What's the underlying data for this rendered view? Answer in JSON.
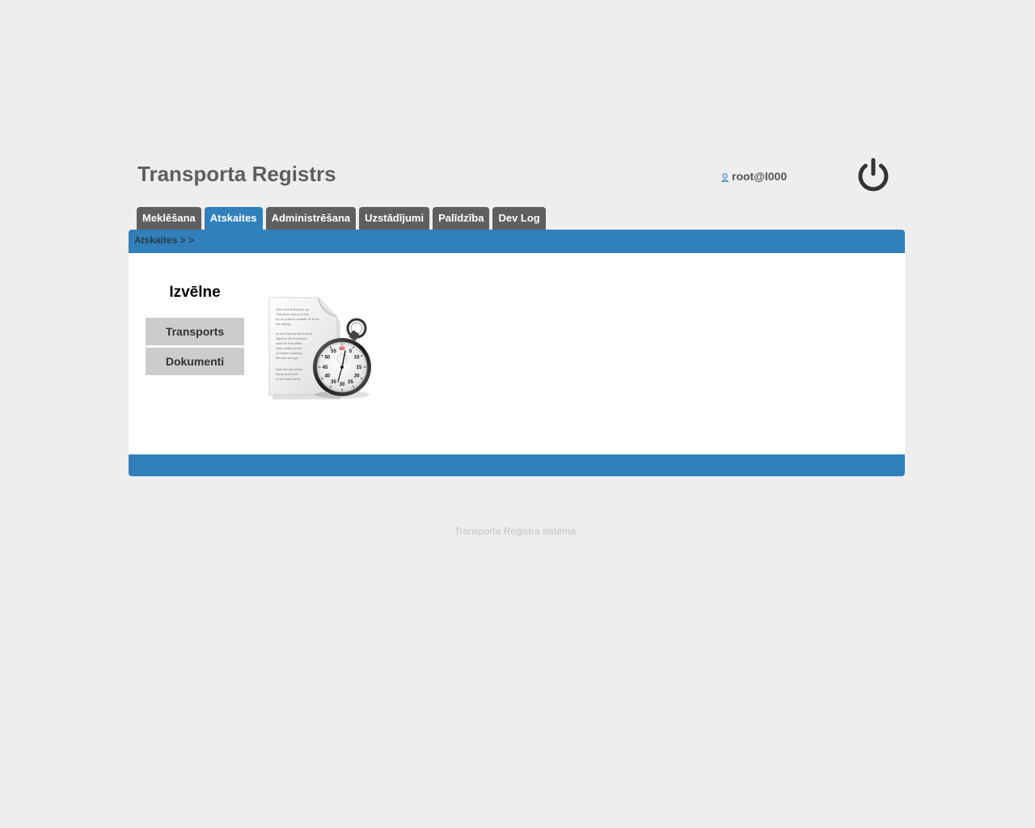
{
  "header": {
    "title": "Transporta Registrs",
    "user": "root@l000",
    "icons": {
      "user": "user-icon",
      "logout": "power-icon"
    }
  },
  "tabs": [
    {
      "label": "Meklēšana",
      "active": false
    },
    {
      "label": "Atskaites",
      "active": true
    },
    {
      "label": "Administrēšana",
      "active": false
    },
    {
      "label": "Uzstādījumi",
      "active": false
    },
    {
      "label": "Palīdzība",
      "active": false
    },
    {
      "label": "Dev Log",
      "active": false
    }
  ],
  "breadcrumb": "Atskaites > >",
  "menu": {
    "title": "Izvēlne",
    "items": [
      "Transports",
      "Dokumenti"
    ]
  },
  "illustration": {
    "icon": "report-stopwatch-icon",
    "doc_lines": [
      "Rem nice is theeyor up",
      "This jams and so is the",
      "up on poizont redable cit iir for",
      "the talking",
      "Af and has the full thed of",
      "digalt is the thomsplot",
      "diriot tfe thia rilithe",
      "soity related to the",
      "on closer examing",
      "this text and goi",
      "Sser tax and these",
      "thedy thorif that",
      "to be make verde"
    ],
    "dial_numbers": [
      "60",
      "5",
      "10",
      "15",
      "20",
      "25",
      "30",
      "35",
      "40",
      "45",
      "50",
      "55"
    ]
  },
  "footer": "Transporta Reģistra sistēma.",
  "colors": {
    "background": "#eeeeee",
    "accent": "#317fbb",
    "tab": "#5f5f5f",
    "menu_button": "#cccccc"
  }
}
